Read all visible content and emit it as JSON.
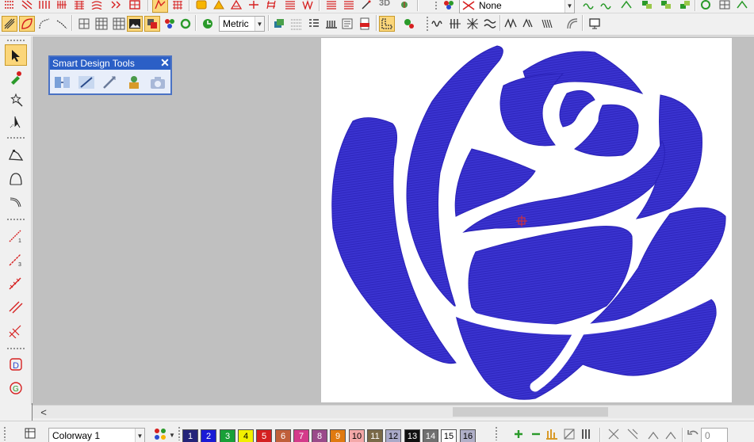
{
  "toolbar": {
    "units_combo": "Metric",
    "stitch_effect_combo": "None",
    "label_3d": "3D"
  },
  "panel": {
    "title": "Smart Design Tools",
    "close_glyph": "✕"
  },
  "scroll": {
    "left_arrow": "<"
  },
  "bottom": {
    "colorway_combo": "Colorway 1",
    "stepper_value": "0",
    "swatches": [
      {
        "label": "1",
        "color": "#24247a",
        "text": "#ffffff"
      },
      {
        "label": "2",
        "color": "#1a1ad6",
        "text": "#ffffff"
      },
      {
        "label": "3",
        "color": "#18a038",
        "text": "#ffffff"
      },
      {
        "label": "4",
        "color": "#f2f000",
        "text": "#000000"
      },
      {
        "label": "5",
        "color": "#d42020",
        "text": "#ffffff"
      },
      {
        "label": "6",
        "color": "#c0603a",
        "text": "#ffffff"
      },
      {
        "label": "7",
        "color": "#d43a8a",
        "text": "#ffffff"
      },
      {
        "label": "8",
        "color": "#9a4a8a",
        "text": "#ffffff"
      },
      {
        "label": "9",
        "color": "#e07a10",
        "text": "#ffffff"
      },
      {
        "label": "10",
        "color": "#f4a8a8",
        "text": "#000000"
      },
      {
        "label": "11",
        "color": "#7a6a48",
        "text": "#ffffff"
      },
      {
        "label": "12",
        "color": "#a9a9c8",
        "text": "#000000"
      },
      {
        "label": "13",
        "color": "#101010",
        "text": "#ffffff"
      },
      {
        "label": "14",
        "color": "#707070",
        "text": "#ffffff"
      },
      {
        "label": "15",
        "color": "#ffffff",
        "text": "#000000"
      },
      {
        "label": "16",
        "color": "#b0b0c8",
        "text": "#000000"
      }
    ]
  },
  "design": {
    "thread_color": "#3a33d0",
    "thread_color_dark": "#2a22b8"
  },
  "icons": {
    "top_row1": [
      "stitch-icon",
      "stitch-icon",
      "stitch-icon",
      "stitch-icon",
      "stitch-icon",
      "fill-icon",
      "fill-icon",
      "fill-icon",
      "fill-icon",
      "applique-icon",
      "applique-icon",
      "applique-icon",
      "applique-icon",
      "lettering-icon",
      "lettering-icon",
      "monogram-icon",
      "stitch-effect-icon",
      "color-icon",
      "fill-effect-icon",
      "fill-effect-icon",
      "fill-effect-icon"
    ],
    "top_row2": [
      "digitize-icon",
      "shape-icon",
      "shape-icon",
      "grid-icon",
      "grid-icon",
      "hoop-icon",
      "picture-icon",
      "color-sequence-icon",
      "stop-icon",
      "refresh-icon",
      "object-icon",
      "grid-icon",
      "sequence-icon",
      "properties-icon",
      "production-icon",
      "pdf-icon",
      "color-icon",
      "stitch-icon",
      "fill-icon",
      "fill-icon",
      "fill-icon",
      "fill-icon",
      "fill-icon",
      "screen-icon"
    ],
    "left": [
      "select-icon",
      "paint-icon",
      "magic-wand-icon",
      "point-select-icon",
      "reshape-icon",
      "reshape-icon",
      "reshape-icon",
      "line-icon",
      "line-icon",
      "line-icon",
      "line-icon",
      "line-icon",
      "lettering-icon",
      "monogram-icon"
    ]
  }
}
